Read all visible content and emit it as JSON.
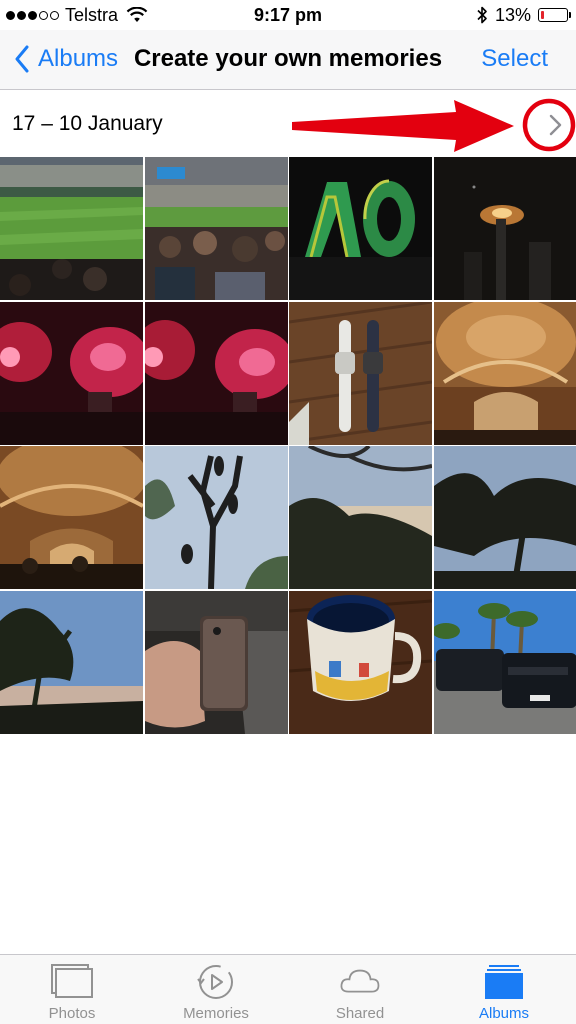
{
  "status_bar": {
    "carrier": "Telstra",
    "time": "9:17 pm",
    "battery_percent": "13%",
    "battery_level": 0.13,
    "signal_bars": 3,
    "signal_total": 5
  },
  "nav": {
    "back_label": "Albums",
    "title": "Create your own memories",
    "select_label": "Select"
  },
  "section": {
    "title": "17 – 10 January"
  },
  "photos": [
    {
      "name": "cricket-stadium-photo"
    },
    {
      "name": "stadium-crowd-photo"
    },
    {
      "name": "ao-sign-photo"
    },
    {
      "name": "tower-fireworks-photo"
    },
    {
      "name": "pink-fireworks-photo"
    },
    {
      "name": "pink-fireworks-photo-2"
    },
    {
      "name": "apple-watches-photo"
    },
    {
      "name": "ornate-ceiling-photo"
    },
    {
      "name": "theatre-interior-photo"
    },
    {
      "name": "bats-in-tree-photo"
    },
    {
      "name": "dusk-treeline-photo"
    },
    {
      "name": "tree-silhouette-photo"
    },
    {
      "name": "eucalyptus-sunset-photo"
    },
    {
      "name": "iphone-in-hand-photo"
    },
    {
      "name": "melbourne-mug-photo"
    },
    {
      "name": "jeeps-palm-trees-photo"
    }
  ],
  "tabs": [
    {
      "label": "Photos",
      "icon": "photos-icon",
      "active": false
    },
    {
      "label": "Memories",
      "icon": "memories-icon",
      "active": false
    },
    {
      "label": "Shared",
      "icon": "cloud-icon",
      "active": false
    },
    {
      "label": "Albums",
      "icon": "albums-icon",
      "active": true
    }
  ],
  "colors": {
    "accent": "#1a7cf5",
    "annotation": "#e3000f",
    "battery_low": "#e3242b"
  }
}
